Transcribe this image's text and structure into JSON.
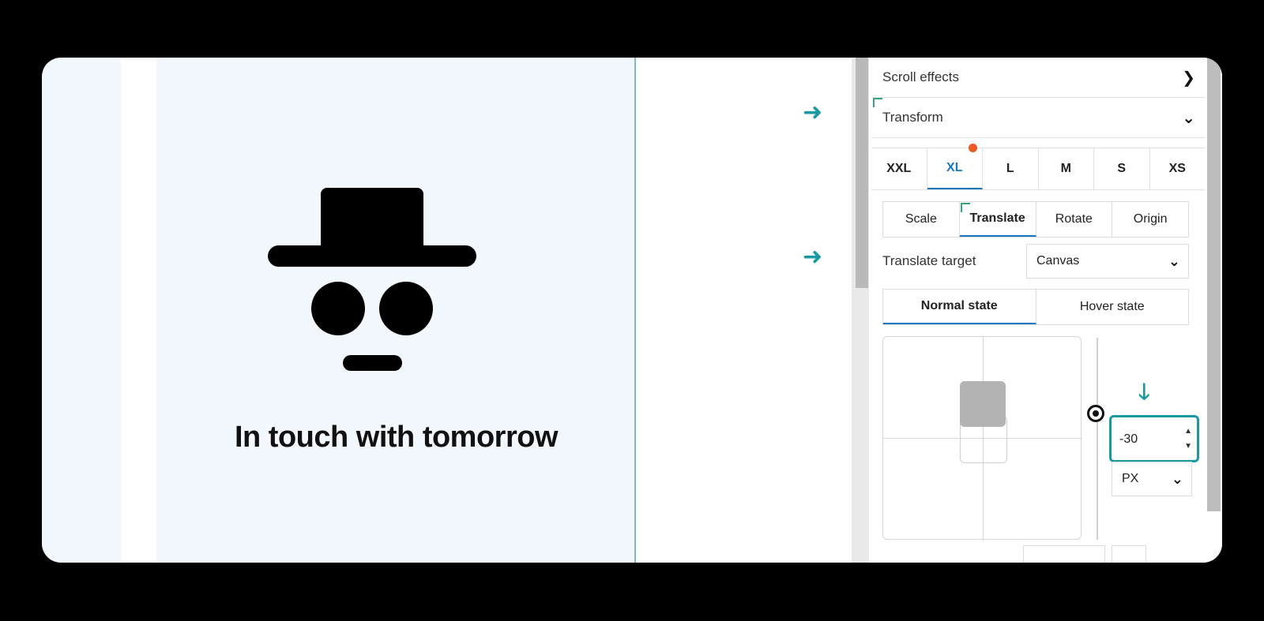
{
  "canvas": {
    "headline": "In touch with tomorrow",
    "logo_icon": "incognito-hat-glasses-icon"
  },
  "panel": {
    "scroll_effects_label": "Scroll effects",
    "transform_label": "Transform",
    "breakpoints": [
      {
        "label": "XXL"
      },
      {
        "label": "XL"
      },
      {
        "label": "L"
      },
      {
        "label": "M"
      },
      {
        "label": "S"
      },
      {
        "label": "XS"
      }
    ],
    "active_breakpoint": "XL",
    "transform_tabs": [
      {
        "label": "Scale"
      },
      {
        "label": "Translate"
      },
      {
        "label": "Rotate"
      },
      {
        "label": "Origin"
      }
    ],
    "active_transform_tab": "Translate",
    "translate_target_label": "Translate target",
    "translate_target_value": "Canvas",
    "state_tabs": [
      {
        "label": "Normal state"
      },
      {
        "label": "Hover state"
      }
    ],
    "active_state": "Normal state",
    "y_value": "-30",
    "unit_value": "PX"
  },
  "colors": {
    "accent": "#1a76bf",
    "highlight": "#199aa0",
    "badge": "#ee5a24"
  }
}
